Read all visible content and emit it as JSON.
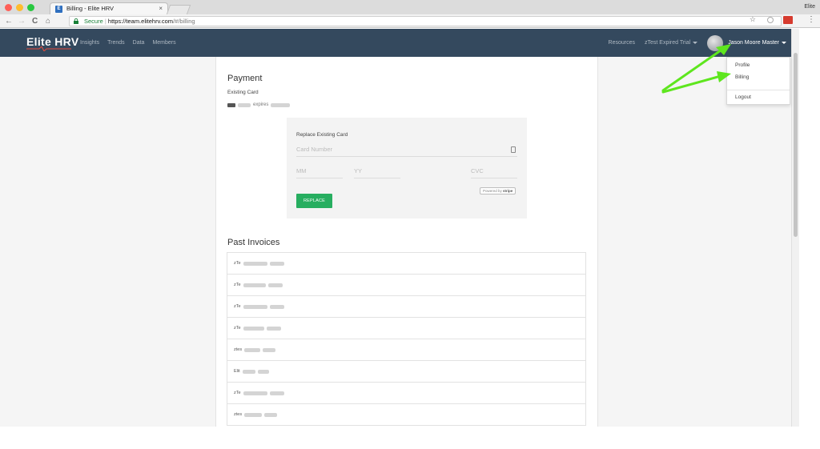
{
  "browser": {
    "tab_title": "Billing - Elite HRV",
    "tab_close": "×",
    "favicon": "E",
    "profile_name": "Elite",
    "secure_label": "Secure",
    "url_sep": "|",
    "url_host": "https://team.elitehrv.com",
    "url_path": "/#/billing",
    "back": "←",
    "forward": "→",
    "reload": "C",
    "home": "⌂",
    "star": "☆",
    "menu": "⋮",
    "colors": {
      "close": "#ff5f57",
      "minimize": "#febc2e",
      "maximize": "#28c840"
    }
  },
  "app": {
    "logo": "Elite HRV",
    "nav_links": [
      "Insights",
      "Trends",
      "Data",
      "Members"
    ],
    "resources": "Resources",
    "trial": "zTest Expired Trial",
    "user_name": "Jason Moore Master",
    "dropdown": [
      "Profile",
      "Billing",
      "Logout"
    ],
    "nav_color": "#34495e",
    "annotation_arrow_color": "#5ee61e"
  },
  "payment": {
    "heading": "Payment",
    "existing_label": "Existing Card",
    "expires": "expires",
    "replace_title": "Replace Existing Card",
    "card_number_placeholder": "Card Number",
    "mm_placeholder": "MM",
    "yy_placeholder": "YY",
    "cvc_placeholder": "CVC",
    "powered_by": "Powered by",
    "stripe": "stripe",
    "replace_button": "REPLACE",
    "button_color": "#27ae60"
  },
  "invoices": {
    "heading": "Past Invoices",
    "rows": [
      {
        "prefix": "zTe"
      },
      {
        "prefix": "zTe"
      },
      {
        "prefix": "zTe"
      },
      {
        "prefix": "zTe"
      },
      {
        "prefix": "ztes"
      },
      {
        "prefix": "Elit"
      },
      {
        "prefix": "zTe"
      },
      {
        "prefix": "ztes"
      }
    ]
  }
}
